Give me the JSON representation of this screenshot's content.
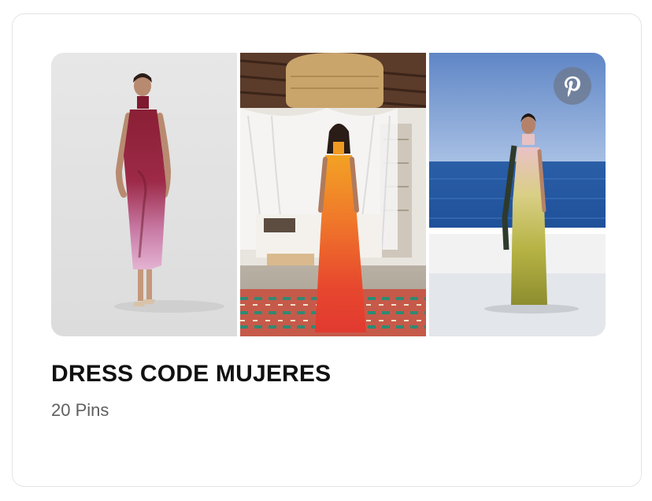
{
  "board": {
    "title": "DRESS CODE MUJERES",
    "pin_count": "20 Pins"
  },
  "images": [
    {
      "icon": "dress-photo-halter-gradient"
    },
    {
      "icon": "dress-photo-orange-gradient"
    },
    {
      "icon": "dress-photo-sea-yellow-gradient"
    }
  ],
  "brand": {
    "icon": "pinterest-logo-icon",
    "accent": "#e60023"
  },
  "colors": {
    "title": "#111111",
    "subtitle": "#5f5f5f",
    "border": "#e4e4e4"
  }
}
